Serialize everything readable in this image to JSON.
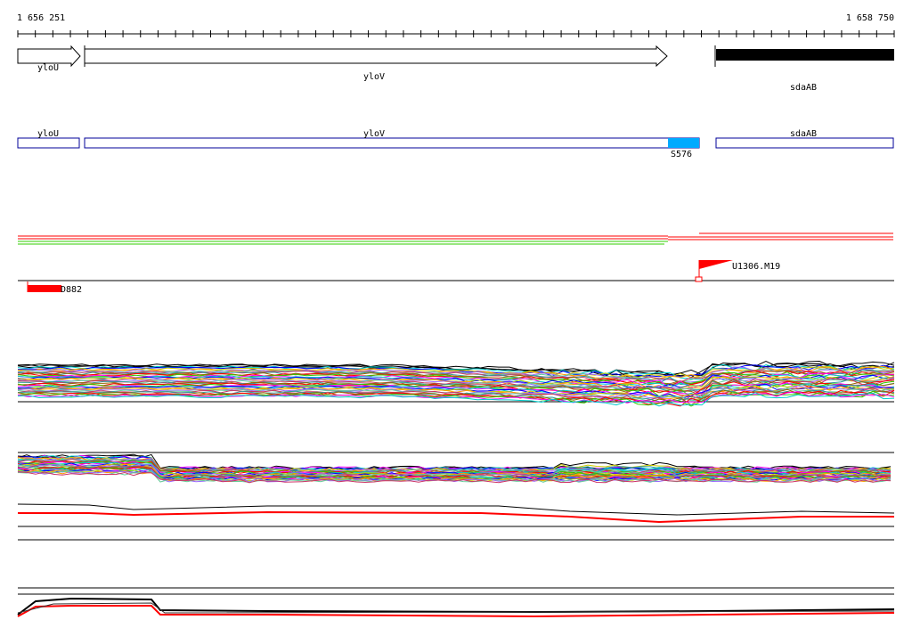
{
  "ruler": {
    "start_label": "1 656 251",
    "end_label": "1 658 750"
  },
  "genes": [
    {
      "name": "yloU",
      "type": "arrow"
    },
    {
      "name": "yloV",
      "type": "arrow"
    },
    {
      "name": "sdaAB",
      "type": "bar",
      "color": "#000000"
    }
  ],
  "segments": [
    {
      "name": "yloU"
    },
    {
      "name": "yloV"
    },
    {
      "name": "sdaAB"
    }
  ],
  "segment_marker": {
    "label": "S576",
    "color": "#00aaff"
  },
  "flag": {
    "label": "U1306.M19",
    "color": "#ff0000"
  },
  "block": {
    "label": "D882",
    "color": "#ff0000"
  },
  "colors": {
    "red": "#ff0000",
    "green": "#33cc00",
    "black": "#000000",
    "segment_outline": "#000099",
    "magenta": "#ff00ff",
    "cyan": "#00cccc",
    "blue": "#0000ff",
    "yellow": "#cccc00",
    "orange": "#ff9900"
  }
}
